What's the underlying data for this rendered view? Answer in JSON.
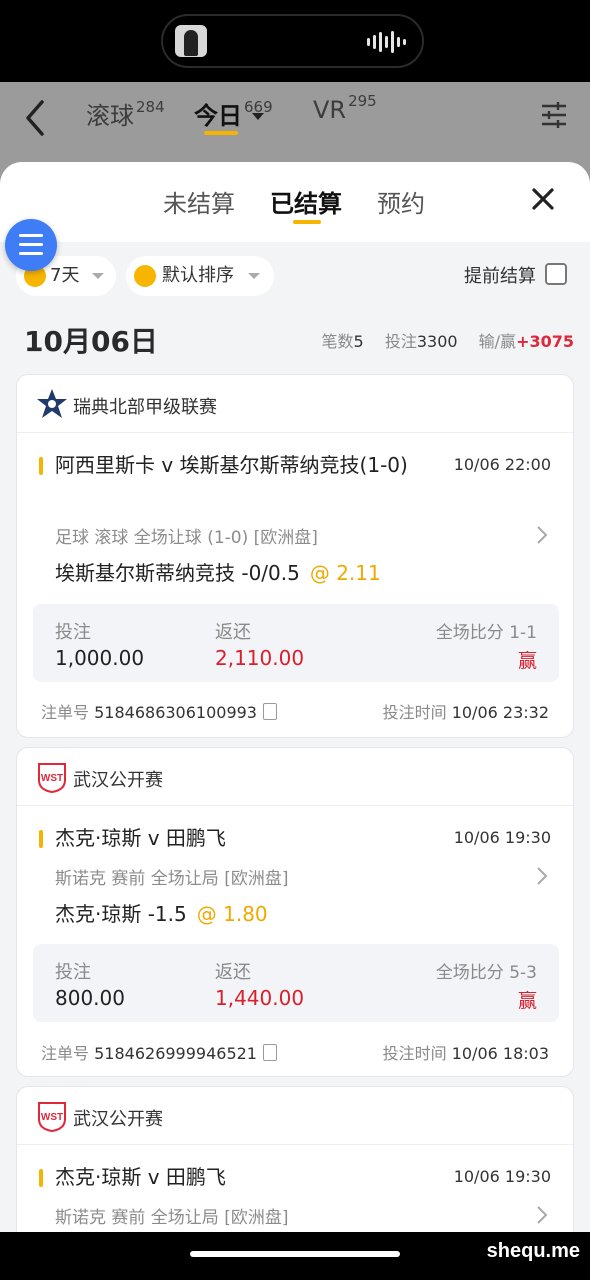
{
  "top_nav": {
    "tabs": [
      {
        "label": "滚球",
        "count": "284"
      },
      {
        "label": "今日",
        "count": "669"
      },
      {
        "label": "VR",
        "count": "295"
      }
    ]
  },
  "sheet": {
    "tabs": [
      "未结算",
      "已结算",
      "预约"
    ],
    "active_tab": "已结算"
  },
  "filters": {
    "days": "7天",
    "sort": "默认排序",
    "early_settle": "提前结算"
  },
  "date_group": {
    "date": "10月06日",
    "count_label": "笔数",
    "count": "5",
    "stake_label": "投注",
    "stake": "3300",
    "pnl_label": "输/赢",
    "pnl": "+3075"
  },
  "labels": {
    "stake": "投注",
    "return": "返还",
    "score": "全场比分",
    "order_no": "注单号",
    "bet_time": "投注时间"
  },
  "cards": [
    {
      "league": "瑞典北部甲级联赛",
      "match": "阿西里斯卡 v 埃斯基尔斯蒂纳竞技(1-0)",
      "match_time": "10/06 22:00",
      "meta": "足球  滚球   全场让球 (1-0) [欧洲盘]",
      "pick": "埃斯基尔斯蒂纳竞技 -0/0.5",
      "odds": "@ 2.11",
      "stake": "1,000.00",
      "return": "2,110.00",
      "score": "1-1",
      "result": "赢",
      "order_no": "5184686306100993",
      "bet_time": "10/06 23:32"
    },
    {
      "league": "武汉公开赛",
      "match": "杰克·琼斯 v 田鹏飞",
      "match_time": "10/06 19:30",
      "meta": "斯诺克  赛前   全场让局  [欧洲盘]",
      "pick": "杰克·琼斯 -1.5",
      "odds": "@ 1.80",
      "stake": "800.00",
      "return": "1,440.00",
      "score": "5-3",
      "result": "赢",
      "order_no": "5184626999946521",
      "bet_time": "10/06 18:03"
    },
    {
      "league": "武汉公开赛",
      "match": "杰克·琼斯 v 田鹏飞",
      "match_time": "10/06 19:30",
      "meta": "斯诺克  赛前   全场让局  [欧洲盘]"
    }
  ],
  "logo_text": "WST",
  "watermark": "shequ.me",
  "colors": {
    "accent": "#f5b400",
    "win": "#d9202d",
    "fab": "#3e7df6"
  }
}
